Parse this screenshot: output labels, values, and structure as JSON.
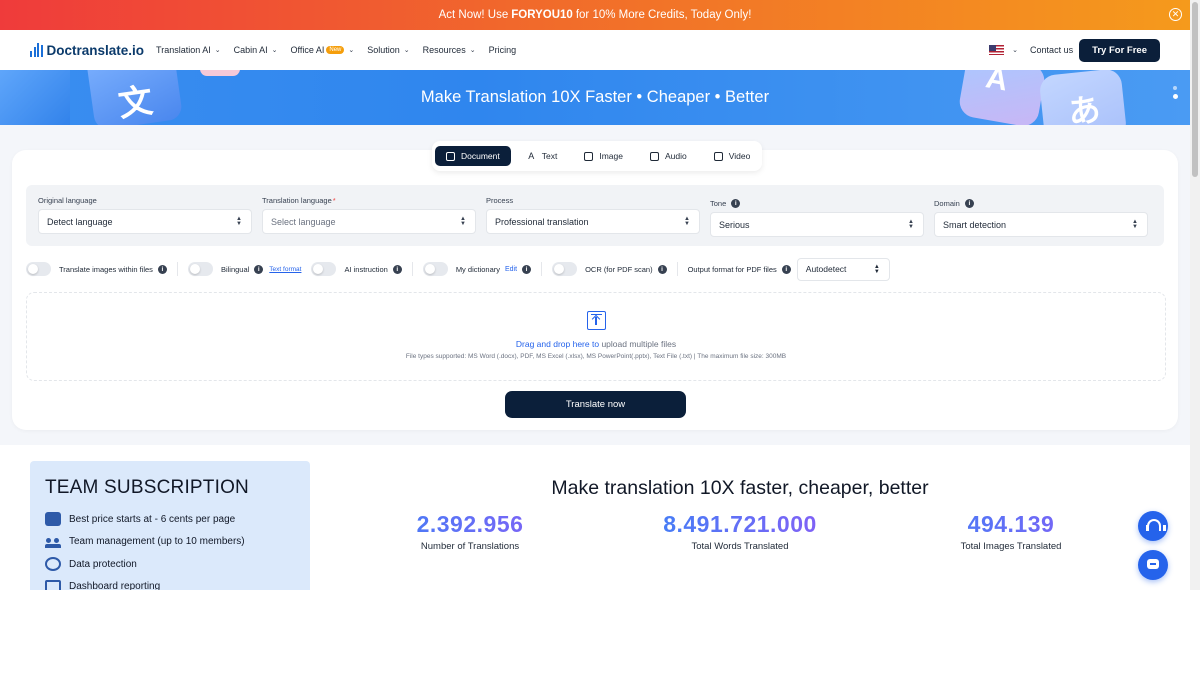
{
  "promo": {
    "text_before": "Act Now! Use",
    "code": "FORYOU10",
    "text_after": "for 10% More Credits, Today Only!"
  },
  "nav": {
    "logo": "Doctranslate.io",
    "items": [
      {
        "label": "Translation AI",
        "dropdown": true
      },
      {
        "label": "Cabin AI",
        "dropdown": true
      },
      {
        "label": "Office AI",
        "badge": "New",
        "dropdown": true
      },
      {
        "label": "Solution",
        "dropdown": true
      },
      {
        "label": "Resources",
        "dropdown": true
      },
      {
        "label": "Pricing",
        "dropdown": false
      }
    ],
    "contact": "Contact us",
    "cta": "Try For Free"
  },
  "hero": {
    "title": "Make Translation 10X Faster • Cheaper • Better"
  },
  "tabs": [
    {
      "label": "Document",
      "active": true
    },
    {
      "label": "Text",
      "active": false
    },
    {
      "label": "Image",
      "active": false
    },
    {
      "label": "Audio",
      "active": false
    },
    {
      "label": "Video",
      "active": false
    }
  ],
  "fields": {
    "original": {
      "label": "Original language",
      "value": "Detect language"
    },
    "translation": {
      "label": "Translation language",
      "required": "*",
      "placeholder": "Select language"
    },
    "process": {
      "label": "Process",
      "value": "Professional translation"
    },
    "tone": {
      "label": "Tone",
      "value": "Serious"
    },
    "domain": {
      "label": "Domain",
      "value": "Smart detection"
    }
  },
  "options": {
    "translate_images": "Translate images within files",
    "bilingual": "Bilingual",
    "bilingual_link": "Text format",
    "ai_instruction": "AI instruction",
    "dictionary": "My dictionary",
    "dictionary_link": "Edit",
    "ocr": "OCR (for PDF scan)",
    "output_format_label": "Output format for PDF files",
    "output_format_value": "Autodetect"
  },
  "dropzone": {
    "highlight": "Drag and drop here to",
    "rest": "upload multiple files",
    "supported": "File types supported: MS Word (.docx), PDF, MS Excel (.xlsx), MS PowerPoint(.pptx), Text File (.txt) | The maximum file size: 300MB"
  },
  "translate_button": "Translate now",
  "team": {
    "title": "TEAM SUBSCRIPTION",
    "items": [
      "Best price starts at - 6 cents per page",
      "Team management (up to 10 members)",
      "Data protection",
      "Dashboard reporting"
    ]
  },
  "stats": {
    "title": "Make translation 10X faster, cheaper, better",
    "items": [
      {
        "value": "2.392.956",
        "label": "Number of Translations"
      },
      {
        "value": "8.491.721.000",
        "label": "Total Words Translated"
      },
      {
        "value": "494.139",
        "label": "Total Images Translated"
      }
    ]
  },
  "colors": {
    "accent": "#2563eb",
    "navy": "#0b1f3a",
    "promo_start": "#ef3b3b",
    "promo_end": "#f59a1c"
  }
}
